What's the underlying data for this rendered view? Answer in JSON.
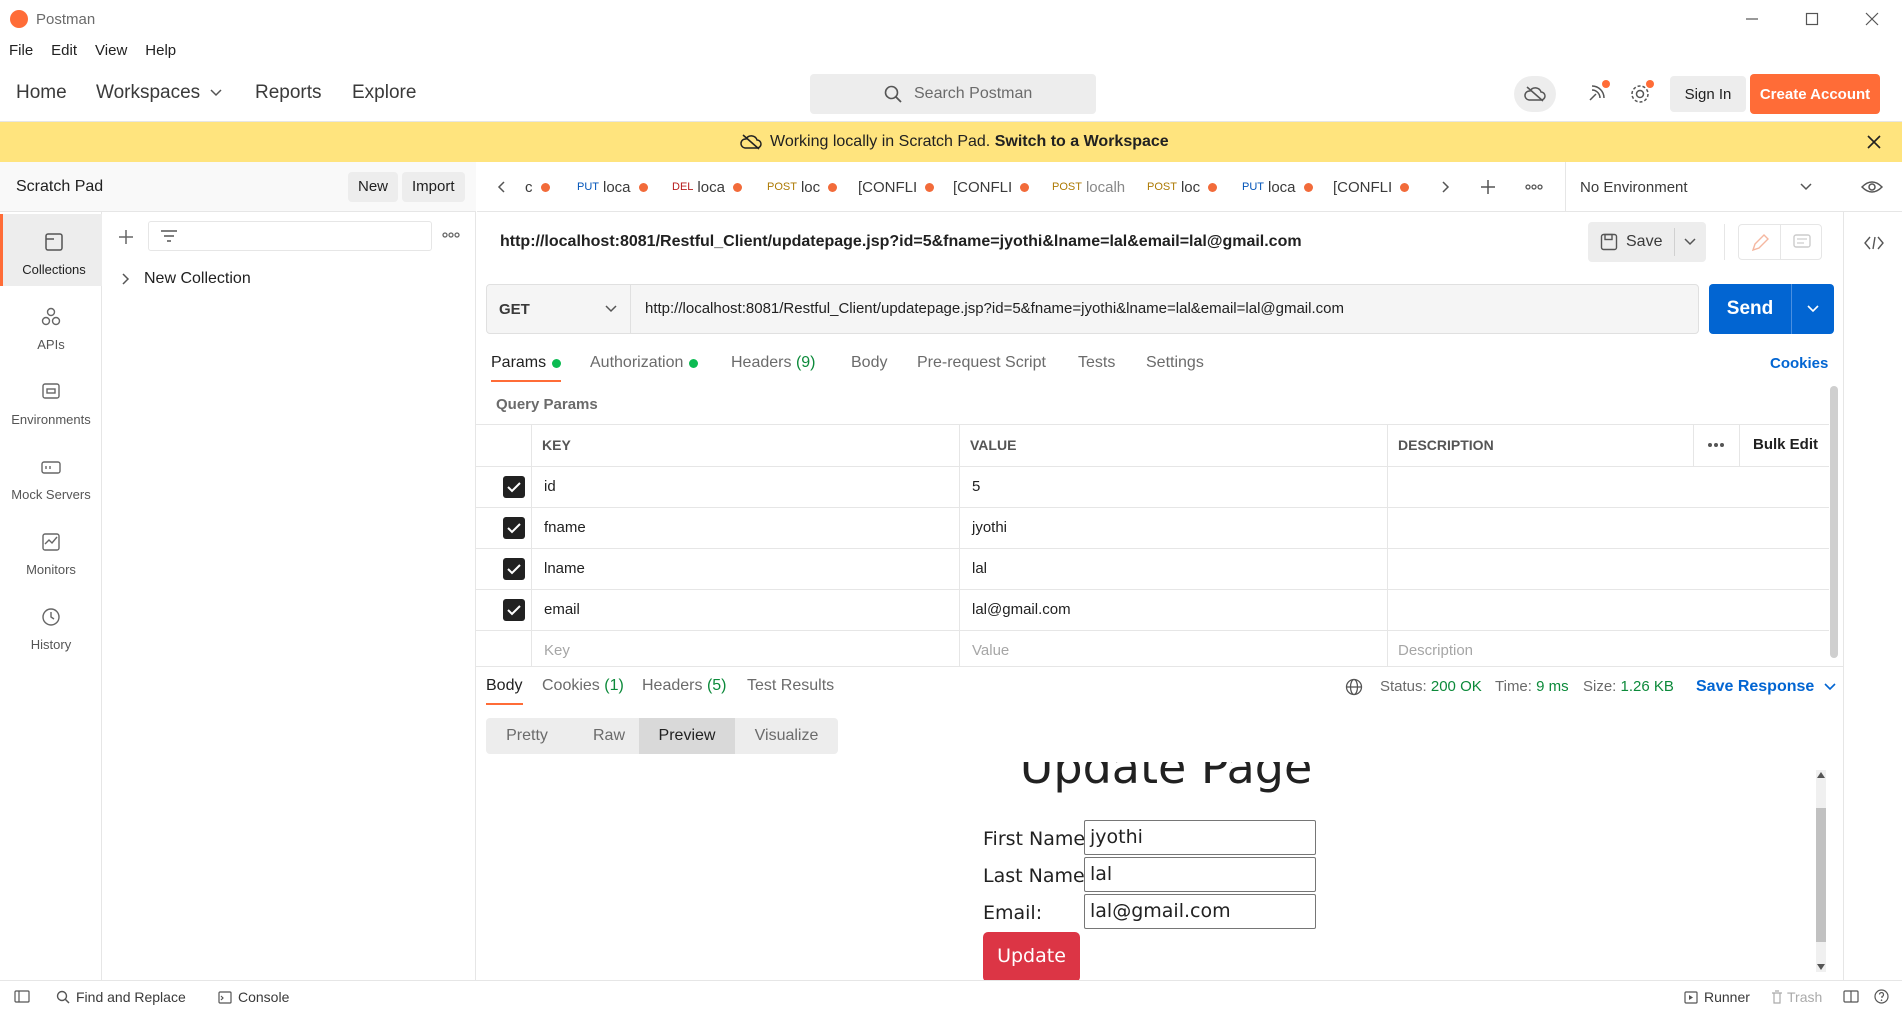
{
  "window": {
    "title": "Postman"
  },
  "menu": [
    "File",
    "Edit",
    "View",
    "Help"
  ],
  "header": {
    "nav": [
      "Home",
      "Workspaces",
      "Reports",
      "Explore"
    ],
    "search_placeholder": "Search Postman",
    "sign_in": "Sign In",
    "create_account": "Create Account"
  },
  "banner": {
    "message": "Working locally in Scratch Pad.",
    "link": "Switch to a Workspace"
  },
  "sidebar": {
    "title": "Scratch Pad",
    "new_label": "New",
    "import_label": "Import",
    "rail": [
      "Collections",
      "APIs",
      "Environments",
      "Mock Servers",
      "Monitors",
      "History"
    ],
    "tree": [
      {
        "label": "New Collection"
      }
    ]
  },
  "tabs": [
    {
      "method": "",
      "label": "c"
    },
    {
      "method": "PUT",
      "label": "loca"
    },
    {
      "method": "DEL",
      "label": "loca"
    },
    {
      "method": "POST",
      "label": "loc"
    },
    {
      "method": "",
      "label": "[CONFLI"
    },
    {
      "method": "",
      "label": "[CONFLI"
    },
    {
      "method": "POST",
      "label": "localh"
    },
    {
      "method": "POST",
      "label": "loc"
    },
    {
      "method": "PUT",
      "label": "loca"
    },
    {
      "method": "",
      "label": "[CONFLI"
    }
  ],
  "environment": "No Environment",
  "request": {
    "title_url": "http://localhost:8081/Restful_Client/updatepage.jsp?id=5&fname=jyothi&lname=lal&email=lal@gmail.com",
    "save_label": "Save",
    "method": "GET",
    "url": "http://localhost:8081/Restful_Client/updatepage.jsp?id=5&fname=jyothi&lname=lal&email=lal@gmail.com",
    "send_label": "Send",
    "subtabs": {
      "params": "Params",
      "authorization": "Authorization",
      "headers": "Headers",
      "headers_count": "(9)",
      "body": "Body",
      "prerequest": "Pre-request Script",
      "tests": "Tests",
      "settings": "Settings",
      "cookies": "Cookies"
    },
    "query_params_title": "Query Params",
    "columns": {
      "key": "KEY",
      "value": "VALUE",
      "description": "DESCRIPTION",
      "bulk_edit": "Bulk Edit"
    },
    "params": [
      {
        "key": "id",
        "value": "5",
        "checked": true
      },
      {
        "key": "fname",
        "value": "jyothi",
        "checked": true
      },
      {
        "key": "lname",
        "value": "lal",
        "checked": true
      },
      {
        "key": "email",
        "value": "lal@gmail.com",
        "checked": true
      }
    ],
    "placeholders": {
      "key": "Key",
      "value": "Value",
      "description": "Description"
    }
  },
  "response": {
    "tabs": {
      "body": "Body",
      "cookies": "Cookies",
      "cookies_count": "(1)",
      "headers": "Headers",
      "headers_count": "(5)",
      "test_results": "Test Results"
    },
    "status_label": "Status:",
    "status_value": "200 OK",
    "time_label": "Time:",
    "time_value": "9 ms",
    "size_label": "Size:",
    "size_value": "1.26 KB",
    "save_response": "Save Response",
    "views": [
      "Pretty",
      "Raw",
      "Preview",
      "Visualize"
    ],
    "active_view": "Preview",
    "preview": {
      "heading": "Update Page",
      "first_name_label": "First Name:",
      "first_name_value": "jyothi",
      "last_name_label": "Last Name:",
      "last_name_value": "lal",
      "email_label": "Email:",
      "email_value": "lal@gmail.com",
      "button": "Update",
      "button_color": "#dc3545"
    }
  },
  "statusbar": {
    "find_replace": "Find and Replace",
    "console": "Console",
    "runner": "Runner",
    "trash": "Trash"
  },
  "colors": {
    "accent": "#ff6c37",
    "send": "#0265d2",
    "banner": "#ffe47e",
    "success": "#0cbb52"
  }
}
